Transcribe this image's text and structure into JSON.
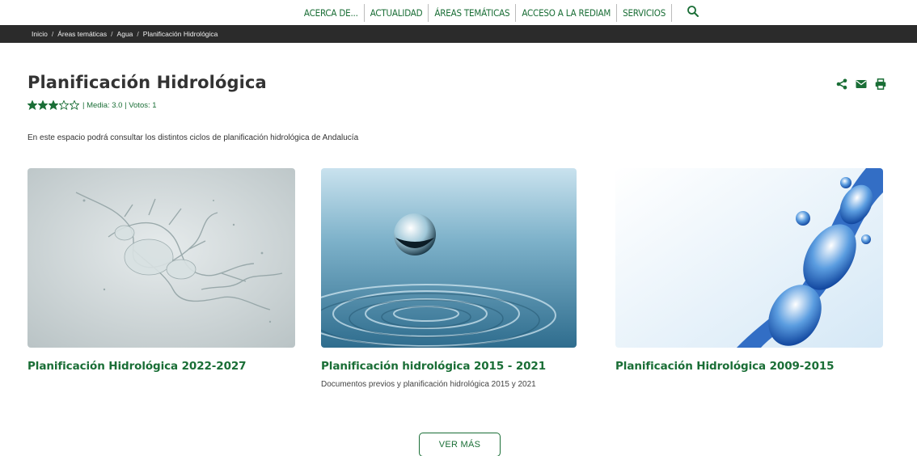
{
  "nav": {
    "items": [
      "ACERCA DE...",
      "ACTUALIDAD",
      "ÁREAS TEMÁTICAS",
      "ACCESO A LA REDIAM",
      "SERVICIOS"
    ]
  },
  "breadcrumb": {
    "items": [
      "Inicio",
      "Áreas temáticas",
      "Agua",
      "Planificación Hidrológica"
    ]
  },
  "page": {
    "title": "Planificación Hidrológica",
    "rating_text": "| Media: 3.0 | Votos: 1",
    "rating_value": 3,
    "rating_max": 5,
    "intro": "En este espacio podrá consultar los distintos ciclos de planificación hidrológica de Andalucía"
  },
  "actions": [
    "share-icon",
    "mail-icon",
    "print-icon"
  ],
  "cards": [
    {
      "title": "Planificación Hidrológica 2022-2027",
      "description": ""
    },
    {
      "title": "Planificación hidrológica 2015 - 2021",
      "description": "Documentos previos y planificación hidrológica 2015 y 2021"
    },
    {
      "title": "Planificación Hidrológica 2009-2015",
      "description": ""
    }
  ],
  "more_button": "VER MÁS",
  "colors": {
    "accent": "#1a6e36",
    "breadcrumb_bg": "#2b2b2b",
    "title": "#333333"
  }
}
